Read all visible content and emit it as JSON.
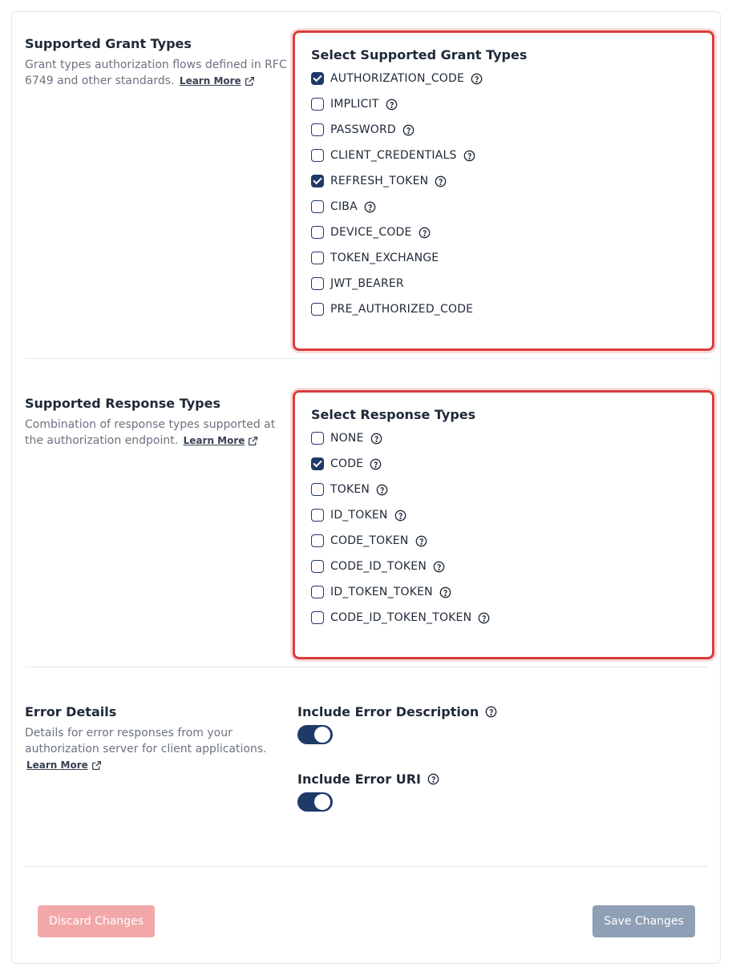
{
  "grant": {
    "title": "Supported Grant Types",
    "desc": "Grant types authorization flows defined in RFC 6749 and other standards.",
    "learn": "Learn More",
    "box_title": "Select Supported Grant Types",
    "options": [
      {
        "label": "AUTHORIZATION_CODE",
        "checked": true,
        "help": true
      },
      {
        "label": "IMPLICIT",
        "checked": false,
        "help": true
      },
      {
        "label": "PASSWORD",
        "checked": false,
        "help": true
      },
      {
        "label": "CLIENT_CREDENTIALS",
        "checked": false,
        "help": true
      },
      {
        "label": "REFRESH_TOKEN",
        "checked": true,
        "help": true
      },
      {
        "label": "CIBA",
        "checked": false,
        "help": true
      },
      {
        "label": "DEVICE_CODE",
        "checked": false,
        "help": true
      },
      {
        "label": "TOKEN_EXCHANGE",
        "checked": false,
        "help": false
      },
      {
        "label": "JWT_BEARER",
        "checked": false,
        "help": false
      },
      {
        "label": "PRE_AUTHORIZED_CODE",
        "checked": false,
        "help": false
      }
    ]
  },
  "response": {
    "title": "Supported Response Types",
    "desc": "Combination of response types supported at the authorization endpoint.",
    "learn": "Learn More",
    "box_title": "Select Response Types",
    "options": [
      {
        "label": "NONE",
        "checked": false,
        "help": true
      },
      {
        "label": "CODE",
        "checked": true,
        "help": true
      },
      {
        "label": "TOKEN",
        "checked": false,
        "help": true
      },
      {
        "label": "ID_TOKEN",
        "checked": false,
        "help": true
      },
      {
        "label": "CODE_TOKEN",
        "checked": false,
        "help": true
      },
      {
        "label": "CODE_ID_TOKEN",
        "checked": false,
        "help": true
      },
      {
        "label": "ID_TOKEN_TOKEN",
        "checked": false,
        "help": true
      },
      {
        "label": "CODE_ID_TOKEN_TOKEN",
        "checked": false,
        "help": true
      }
    ]
  },
  "errors": {
    "title": "Error Details",
    "desc": "Details for error responses from your authorization server for client applications.",
    "learn": "Learn More",
    "desc_label": "Include Error Description",
    "desc_on": true,
    "uri_label": "Include Error URI",
    "uri_on": true
  },
  "footer": {
    "discard": "Discard Changes",
    "save": "Save Changes"
  },
  "colors": {
    "accent": "#1f3a68",
    "highlight": "#dc3c3c",
    "discard_bg": "#f2a8a8",
    "save_bg": "#8e9fb6"
  }
}
